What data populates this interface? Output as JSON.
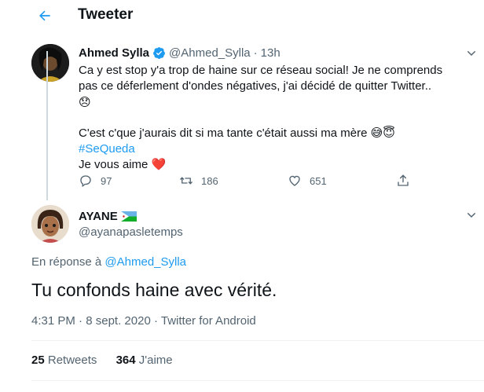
{
  "header": {
    "title": "Tweeter",
    "back_icon": "arrow-left-icon"
  },
  "parent_tweet": {
    "name": "Ahmed Sylla",
    "handle": "@Ahmed_Sylla",
    "dot": "·",
    "time": "13h",
    "lines": [
      "Ca y est stop y'a trop de haine sur ce réseau social! Je ne comprends",
      "pas ce déferlement d'ondes négatives, j'ai décidé de quitter Twitter..",
      "😞",
      "",
      "C'est c'que j'aurais dit si ma tante c'était aussi ma mère 😅😇",
      "#SeQueda",
      "Je vous aime ❤️"
    ],
    "hashtag": "#SeQueda",
    "actions": {
      "replies": "97",
      "retweets": "186",
      "likes": "651"
    }
  },
  "reply_tweet": {
    "name": "AYANE",
    "handle": "@ayanapasletemps",
    "reply_prefix": "En réponse à",
    "reply_to": "@Ahmed_Sylla",
    "text": "Tu confonds haine avec vérité.",
    "timestamp_time": "4:31 PM",
    "timestamp_date": "8 sept. 2020",
    "timestamp_source": "Twitter for Android",
    "sep": "·",
    "retweets_count": "25",
    "retweets_label": "Retweets",
    "likes_count": "364",
    "likes_label": "J'aime"
  },
  "colors": {
    "accent": "#1d9bf0",
    "muted": "#536471",
    "text": "#0f1419",
    "heart": "#e0245e"
  }
}
